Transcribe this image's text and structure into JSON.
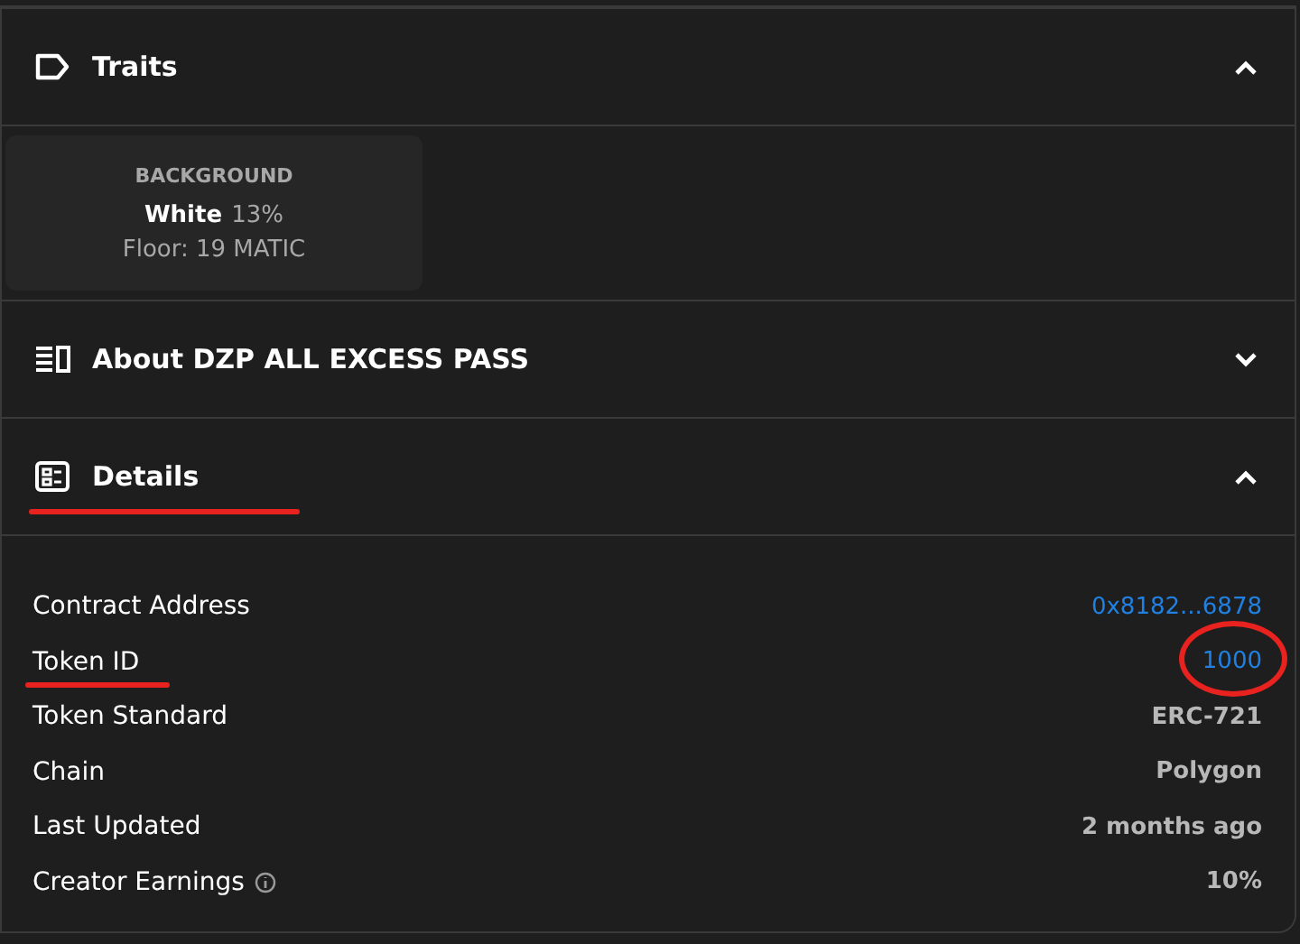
{
  "sections": [
    {
      "kind": "traits",
      "title": "Traits",
      "expanded": true,
      "traits": [
        {
          "type": "BACKGROUND",
          "value": "White",
          "share": "13%",
          "floor": "Floor: 19 MATIC"
        }
      ]
    },
    {
      "kind": "about",
      "title": "About DZP ALL EXCESS PASS",
      "expanded": false
    },
    {
      "kind": "details",
      "title": "Details",
      "expanded": true,
      "underlined": true,
      "rows": [
        {
          "label": "Contract Address",
          "value": "0x8182...6878",
          "kind": "link"
        },
        {
          "label": "Token ID",
          "value": "1000",
          "kind": "link",
          "label_underlined": true,
          "value_circled": true
        },
        {
          "label": "Token Standard",
          "value": "ERC-721",
          "kind": "text"
        },
        {
          "label": "Chain",
          "value": "Polygon",
          "kind": "text"
        },
        {
          "label": "Last Updated",
          "value": "2 months ago",
          "kind": "text"
        },
        {
          "label": "Creator Earnings",
          "value": "10%",
          "kind": "text",
          "info": true
        }
      ]
    }
  ]
}
